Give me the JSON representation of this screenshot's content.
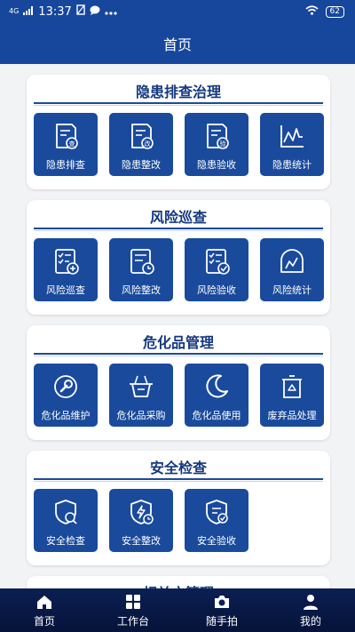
{
  "status_bar": {
    "network": "4G",
    "time": "13:37",
    "battery": "62"
  },
  "header": {
    "title": "首页"
  },
  "sections": [
    {
      "title": "隐患排查治理",
      "items": [
        {
          "label": "隐患排查",
          "icon": "doc-check-icon"
        },
        {
          "label": "隐患整改",
          "icon": "doc-edit-icon"
        },
        {
          "label": "隐患验收",
          "icon": "doc-accept-icon"
        },
        {
          "label": "隐患统计",
          "icon": "line-chart-icon"
        }
      ]
    },
    {
      "title": "风险巡查",
      "items": [
        {
          "label": "风险巡查",
          "icon": "checklist-add-icon"
        },
        {
          "label": "风险整改",
          "icon": "doc-clock-icon"
        },
        {
          "label": "风险验收",
          "icon": "checklist-check-icon"
        },
        {
          "label": "风险统计",
          "icon": "gauge-chart-icon"
        }
      ]
    },
    {
      "title": "危化品管理",
      "items": [
        {
          "label": "危化品维护",
          "icon": "wrench-icon"
        },
        {
          "label": "危化品采购",
          "icon": "basket-icon"
        },
        {
          "label": "危化品使用",
          "icon": "moon-icon"
        },
        {
          "label": "废弃品处理",
          "icon": "recycle-bin-icon"
        }
      ]
    },
    {
      "title": "安全检查",
      "items": [
        {
          "label": "安全检查",
          "icon": "shield-search-icon"
        },
        {
          "label": "安全整改",
          "icon": "shield-bolt-icon"
        },
        {
          "label": "安全验收",
          "icon": "shield-check-icon"
        }
      ]
    },
    {
      "title": "相关方管理"
    }
  ],
  "tabbar": {
    "items": [
      {
        "label": "首页",
        "icon": "home-icon"
      },
      {
        "label": "工作台",
        "icon": "grid-icon"
      },
      {
        "label": "随手拍",
        "icon": "camera-icon"
      },
      {
        "label": "我的",
        "icon": "user-icon"
      }
    ]
  },
  "colors": {
    "primary": "#17479c",
    "tile": "#1a4a9b",
    "title": "#14387e",
    "tabbar": "#0b1f52"
  }
}
